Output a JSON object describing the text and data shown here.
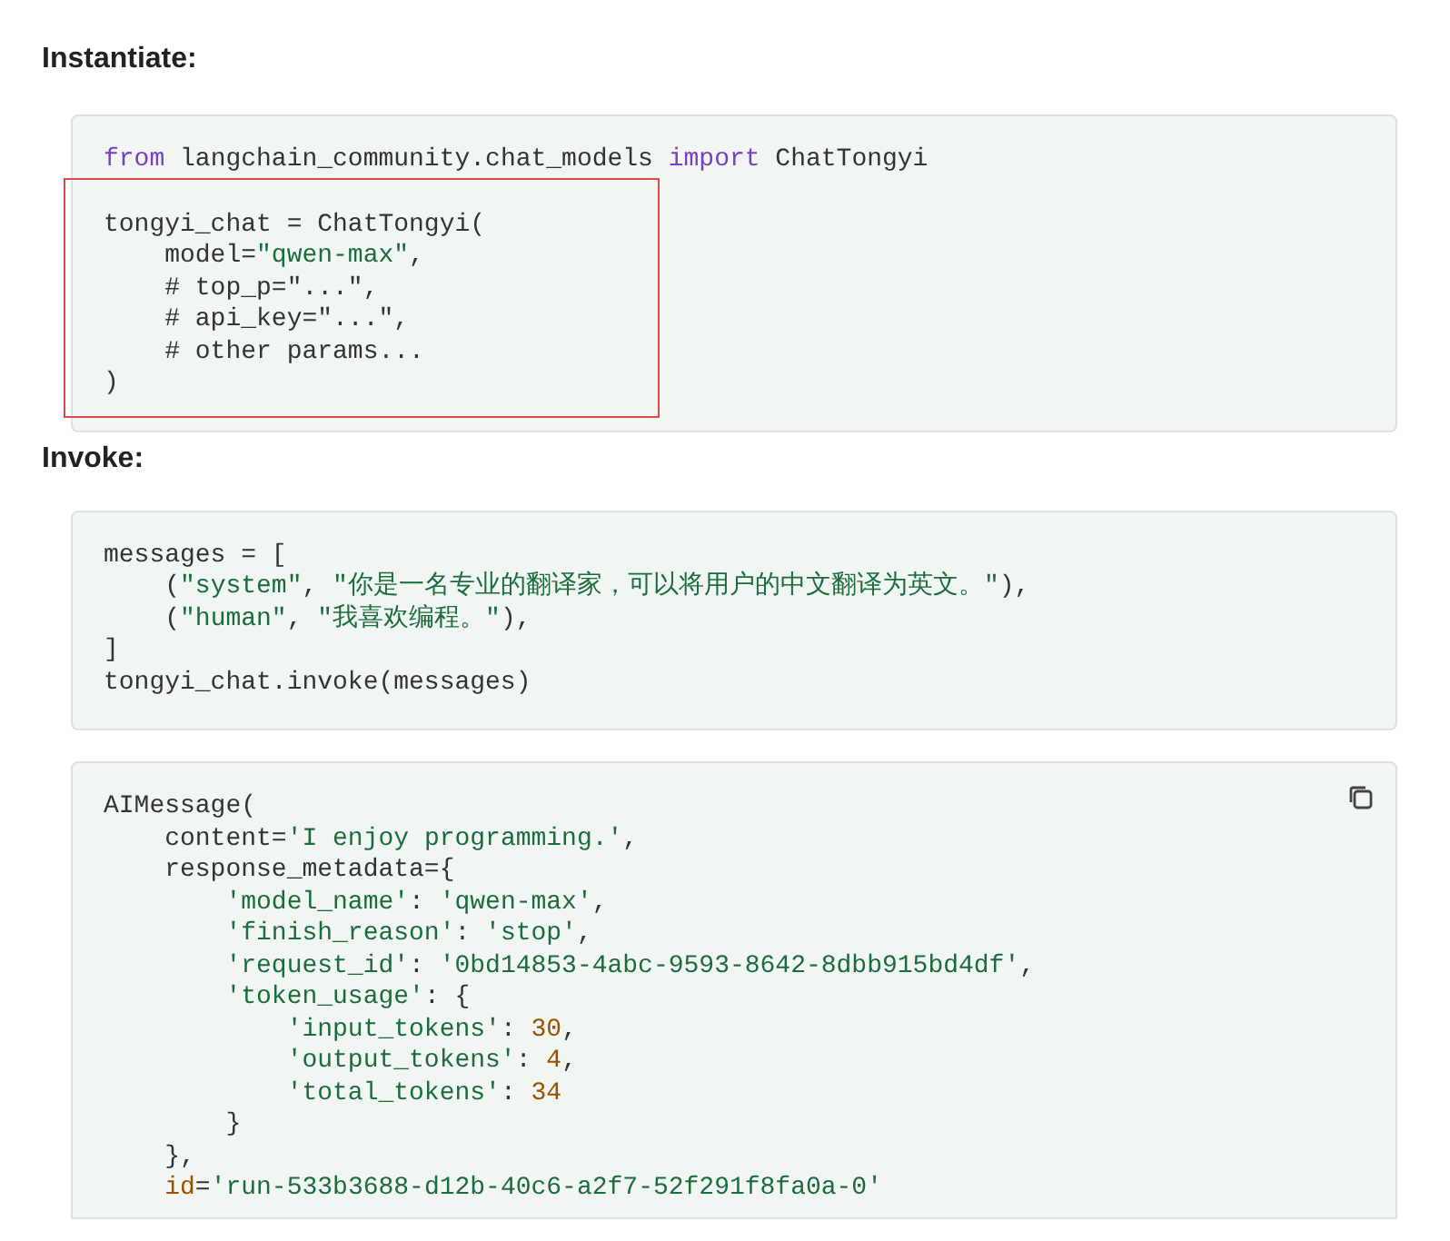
{
  "sections": [
    {
      "heading": "Instantiate:",
      "blocks": [
        {
          "copy_button": false,
          "segments": [
            {
              "boxed": false,
              "lines": [
                {
                  "tokens": [
                    {
                      "kind": "keyword",
                      "text": "from"
                    },
                    {
                      "kind": "plain",
                      "text": " langchain_community.chat_models "
                    },
                    {
                      "kind": "keyword",
                      "text": "import"
                    },
                    {
                      "kind": "plain",
                      "text": " ChatTongyi"
                    }
                  ]
                }
              ]
            },
            {
              "boxed": true,
              "lines": [
                {
                  "tokens": [
                    {
                      "kind": "plain",
                      "text": "tongyi_chat = ChatTongyi("
                    }
                  ]
                },
                {
                  "tokens": [
                    {
                      "kind": "plain",
                      "text": "    model="
                    },
                    {
                      "kind": "string",
                      "text": "\"qwen-max\""
                    },
                    {
                      "kind": "plain",
                      "text": ","
                    }
                  ]
                },
                {
                  "tokens": [
                    {
                      "kind": "plain",
                      "text": "    # top_p=\"...\","
                    }
                  ]
                },
                {
                  "tokens": [
                    {
                      "kind": "plain",
                      "text": "    # api_key=\"...\","
                    }
                  ]
                },
                {
                  "tokens": [
                    {
                      "kind": "plain",
                      "text": "    # other params..."
                    }
                  ]
                },
                {
                  "tokens": [
                    {
                      "kind": "plain",
                      "text": ")"
                    }
                  ]
                }
              ]
            }
          ]
        }
      ]
    },
    {
      "heading": "Invoke:",
      "blocks": [
        {
          "copy_button": false,
          "lines": [
            {
              "tokens": [
                {
                  "kind": "plain",
                  "text": "messages = ["
                }
              ]
            },
            {
              "tokens": [
                {
                  "kind": "plain",
                  "text": "    ("
                },
                {
                  "kind": "string",
                  "text": "\"system\""
                },
                {
                  "kind": "plain",
                  "text": ", "
                },
                {
                  "kind": "string",
                  "text": "\"你是一名专业的翻译家，可以将用户的中文翻译为英文。\""
                },
                {
                  "kind": "plain",
                  "text": "),"
                }
              ]
            },
            {
              "tokens": [
                {
                  "kind": "plain",
                  "text": "    ("
                },
                {
                  "kind": "string",
                  "text": "\"human\""
                },
                {
                  "kind": "plain",
                  "text": ", "
                },
                {
                  "kind": "string",
                  "text": "\"我喜欢编程。\""
                },
                {
                  "kind": "plain",
                  "text": "),"
                }
              ]
            },
            {
              "tokens": [
                {
                  "kind": "plain",
                  "text": "]"
                }
              ]
            },
            {
              "tokens": [
                {
                  "kind": "plain",
                  "text": "tongyi_chat.invoke(messages)"
                }
              ]
            }
          ]
        },
        {
          "copy_button": true,
          "lines": [
            {
              "tokens": [
                {
                  "kind": "plain",
                  "text": "AIMessage("
                }
              ]
            },
            {
              "tokens": [
                {
                  "kind": "plain",
                  "text": "    content="
                },
                {
                  "kind": "string",
                  "text": "'I enjoy programming.'"
                },
                {
                  "kind": "plain",
                  "text": ","
                }
              ]
            },
            {
              "tokens": [
                {
                  "kind": "plain",
                  "text": "    response_metadata={"
                }
              ]
            },
            {
              "tokens": [
                {
                  "kind": "string",
                  "text": "        'model_name'"
                },
                {
                  "kind": "plain",
                  "text": ": "
                },
                {
                  "kind": "string",
                  "text": "'qwen-max'"
                },
                {
                  "kind": "plain",
                  "text": ","
                }
              ]
            },
            {
              "tokens": [
                {
                  "kind": "string",
                  "text": "        'finish_reason'"
                },
                {
                  "kind": "plain",
                  "text": ": "
                },
                {
                  "kind": "string",
                  "text": "'stop'"
                },
                {
                  "kind": "plain",
                  "text": ","
                }
              ]
            },
            {
              "tokens": [
                {
                  "kind": "string",
                  "text": "        'request_id'"
                },
                {
                  "kind": "plain",
                  "text": ": "
                },
                {
                  "kind": "string",
                  "text": "'0bd14853-4abc-9593-8642-8dbb915bd4df'"
                },
                {
                  "kind": "plain",
                  "text": ","
                }
              ]
            },
            {
              "tokens": [
                {
                  "kind": "string",
                  "text": "        'token_usage'"
                },
                {
                  "kind": "plain",
                  "text": ": {"
                }
              ]
            },
            {
              "tokens": [
                {
                  "kind": "string",
                  "text": "            'input_tokens'"
                },
                {
                  "kind": "plain",
                  "text": ": "
                },
                {
                  "kind": "number",
                  "text": "30"
                },
                {
                  "kind": "plain",
                  "text": ","
                }
              ]
            },
            {
              "tokens": [
                {
                  "kind": "string",
                  "text": "            'output_tokens'"
                },
                {
                  "kind": "plain",
                  "text": ": "
                },
                {
                  "kind": "number",
                  "text": "4"
                },
                {
                  "kind": "plain",
                  "text": ","
                }
              ]
            },
            {
              "tokens": [
                {
                  "kind": "string",
                  "text": "            'total_tokens'"
                },
                {
                  "kind": "plain",
                  "text": ": "
                },
                {
                  "kind": "number",
                  "text": "34"
                }
              ]
            },
            {
              "tokens": [
                {
                  "kind": "plain",
                  "text": "        }"
                }
              ]
            },
            {
              "tokens": [
                {
                  "kind": "plain",
                  "text": "    },"
                }
              ]
            },
            {
              "tokens": [
                {
                  "kind": "name",
                  "text": "    id"
                },
                {
                  "kind": "plain",
                  "text": "="
                },
                {
                  "kind": "string",
                  "text": "'run-533b3688-d12b-40c6-a2f7-52f291f8fa0a-0'"
                }
              ]
            }
          ]
        }
      ]
    }
  ]
}
